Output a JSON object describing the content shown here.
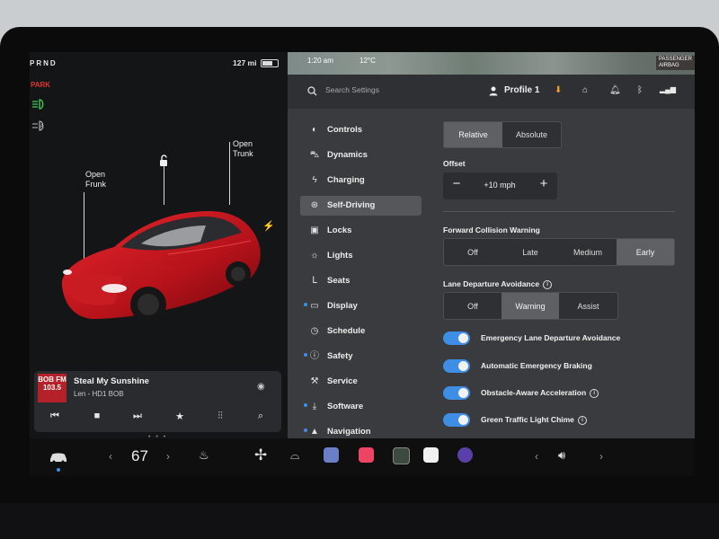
{
  "status": {
    "gear": "PRND",
    "range": "127 mi",
    "park": "PARK"
  },
  "car": {
    "open_frunk": "Open\nFrunk",
    "open_trunk": "Open\nTrunk"
  },
  "media": {
    "logo": "BOB FM 103.5",
    "track": "Steal My Sunshine",
    "station": "Len - HD1 BOB",
    "prev": "⏮",
    "stop": "■",
    "next": "⏭",
    "fav": "★",
    "eq": "⫶⫶",
    "search": "⌕"
  },
  "map": {
    "time": "1:20 am",
    "temp": "12°C",
    "aqi": "PASSENGER AIRBAG"
  },
  "top": {
    "search_placeholder": "Search Settings",
    "profile": "Profile 1"
  },
  "nav": [
    {
      "label": "Controls",
      "icon": "toggle-icon"
    },
    {
      "label": "Dynamics",
      "icon": "car-icon"
    },
    {
      "label": "Charging",
      "icon": "bolt-icon"
    },
    {
      "label": "Self-Driving",
      "icon": "steering-wheel-icon"
    },
    {
      "label": "Locks",
      "icon": "lock-icon"
    },
    {
      "label": "Lights",
      "icon": "sun-icon"
    },
    {
      "label": "Seats",
      "icon": "seat-icon"
    },
    {
      "label": "Display",
      "icon": "display-icon"
    },
    {
      "label": "Schedule",
      "icon": "clock-icon"
    },
    {
      "label": "Safety",
      "icon": "info-icon"
    },
    {
      "label": "Service",
      "icon": "wrench-icon"
    },
    {
      "label": "Software",
      "icon": "download-icon"
    },
    {
      "label": "Navigation",
      "icon": "navigation-icon"
    }
  ],
  "self_driving": {
    "mode_relative": "Relative",
    "mode_absolute": "Absolute",
    "offset_label": "Offset",
    "offset_value": "+10 mph",
    "fcw_label": "Forward Collision Warning",
    "fcw_options": [
      "Off",
      "Late",
      "Medium",
      "Early"
    ],
    "lda_label": "Lane Departure Avoidance",
    "lda_options": [
      "Off",
      "Warning",
      "Assist"
    ],
    "toggles": [
      "Emergency Lane Departure Avoidance",
      "Automatic Emergency Braking",
      "Obstacle-Aware Acceleration",
      "Green Traffic Light Chime"
    ]
  },
  "taskbar": {
    "temperature": "67",
    "left_chev": "‹",
    "right_chev": "›"
  },
  "colors": {
    "accent": "#3e8ee5",
    "car_red": "#c2161c",
    "park_red": "#e0342b"
  }
}
